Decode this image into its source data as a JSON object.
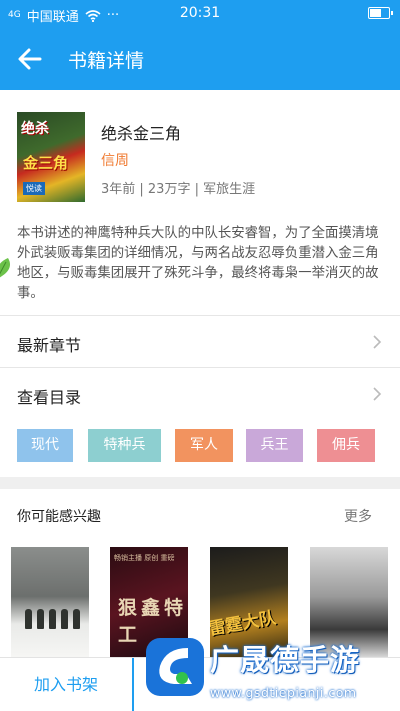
{
  "status_bar": {
    "carrier": "中国联通",
    "signal": "4G",
    "more": "···",
    "time": "20:31"
  },
  "header": {
    "title": "书籍详情",
    "accent_color": "#1e9ef0"
  },
  "book": {
    "cover_text_top": "绝杀",
    "cover_text_mid": "金三角",
    "cover_badge": "悦读",
    "title": "绝杀金三角",
    "author": "信周",
    "meta": "3年前 | 23万字 | 军旅生涯",
    "description": "本书讲述的神鹰特种兵大队的中队长安睿智，为了全面摸清境外武装贩毒集团的详细情况，与两名战友忍辱负重潜入金三角地区，与贩毒集团展开了殊死斗争，最终将毒枭一举消灭的故事。"
  },
  "rows": {
    "latest_chapter": "最新章节",
    "catalog": "查看目录"
  },
  "tags": [
    {
      "label": "现代",
      "color": "#8fc3ec"
    },
    {
      "label": "特种兵",
      "color": "#8dcfd0"
    },
    {
      "label": "军人",
      "color": "#f2935f"
    },
    {
      "label": "兵王",
      "color": "#c9a8d9"
    },
    {
      "label": "佣兵",
      "color": "#ee8f93"
    }
  ],
  "recommend": {
    "title": "你可能感兴趣",
    "more": "更多",
    "covers": [
      {
        "title": ""
      },
      {
        "title": "狠鑫特工",
        "subtitle": "畅销主播 原创 重磅"
      },
      {
        "title": "雷霆大队"
      },
      {
        "title": ""
      }
    ]
  },
  "bottom_bar": {
    "add_to_shelf": "加入书架"
  },
  "watermark": {
    "brand": "广晟德手游",
    "url": "www.gsdtiepianji.com"
  }
}
